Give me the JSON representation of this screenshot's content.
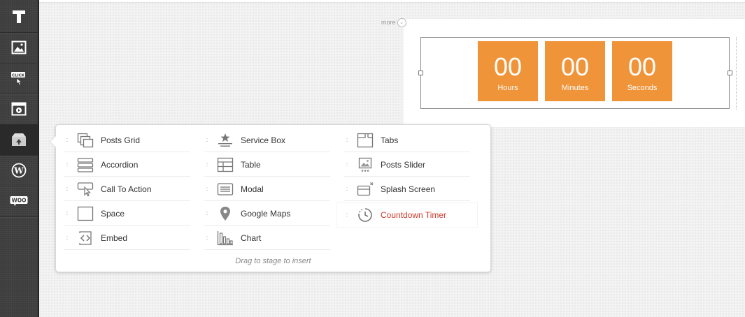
{
  "toolbar": {
    "items": [
      {
        "icon": "text-icon"
      },
      {
        "icon": "image-icon"
      },
      {
        "icon": "click-button-icon",
        "label": "CLICK"
      },
      {
        "icon": "video-icon"
      },
      {
        "icon": "package-icon"
      },
      {
        "icon": "wordpress-icon"
      },
      {
        "icon": "woo-icon",
        "label": "WOO"
      }
    ]
  },
  "stage": {
    "more_label": "more",
    "countdown": {
      "accent": "#f0943a",
      "boxes": [
        {
          "value": "00",
          "label": "Hours"
        },
        {
          "value": "00",
          "label": "Minutes"
        },
        {
          "value": "00",
          "label": "Seconds"
        }
      ]
    }
  },
  "popup": {
    "columns": [
      [
        {
          "label": "Posts Grid",
          "icon": "posts-grid-icon"
        },
        {
          "label": "Accordion",
          "icon": "accordion-icon"
        },
        {
          "label": "Call To Action",
          "icon": "call-to-action-icon"
        },
        {
          "label": "Space",
          "icon": "space-icon"
        },
        {
          "label": "Embed",
          "icon": "embed-icon"
        }
      ],
      [
        {
          "label": "Service Box",
          "icon": "service-box-icon"
        },
        {
          "label": "Table",
          "icon": "table-icon"
        },
        {
          "label": "Modal",
          "icon": "modal-icon"
        },
        {
          "label": "Google Maps",
          "icon": "map-pin-icon"
        },
        {
          "label": "Chart",
          "icon": "chart-icon"
        }
      ],
      [
        {
          "label": "Tabs",
          "icon": "tabs-icon"
        },
        {
          "label": "Posts Slider",
          "icon": "posts-slider-icon"
        },
        {
          "label": "Splash Screen",
          "icon": "splash-screen-icon"
        },
        {
          "label": "Countdown Timer",
          "icon": "countdown-timer-icon",
          "selected": true
        }
      ]
    ],
    "hint": "Drag to stage to insert",
    "selected_color": "#d0392b"
  }
}
